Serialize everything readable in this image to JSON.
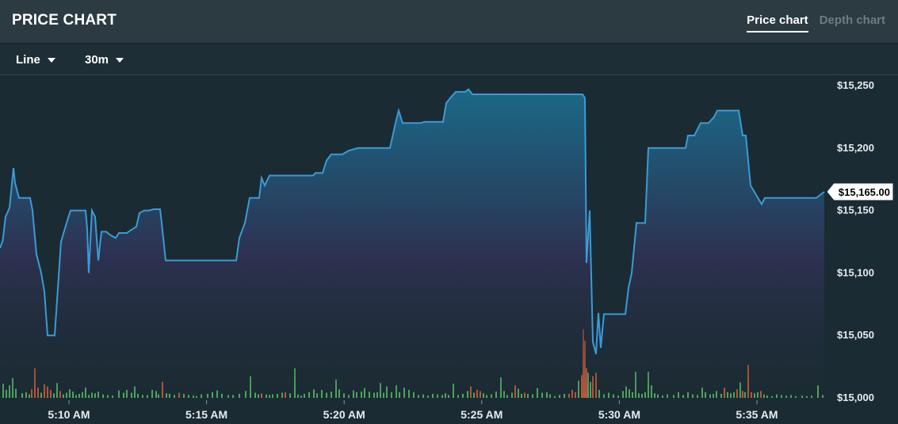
{
  "header": {
    "title": "PRICE CHART",
    "tabs": [
      {
        "label": "Price chart",
        "active": true
      },
      {
        "label": "Depth chart",
        "active": false
      }
    ]
  },
  "toolbar": {
    "chart_type": "Line",
    "interval": "30m"
  },
  "colors": {
    "line": "#3a9bd5",
    "volume_up": "#5cc46b",
    "volume_down": "#e0623a",
    "gradient_top": "#1a6c8c",
    "gradient_mid": "#2e3152"
  },
  "chart_data": {
    "type": "area",
    "xlabel": "",
    "ylabel": "",
    "ylim": [
      15000,
      15250
    ],
    "y_ticks": [
      "$15,250",
      "$15,200",
      "$15,150",
      "$15,100",
      "$15,050",
      "$15,000"
    ],
    "x_ticks": [
      "5:10 AM",
      "5:15 AM",
      "5:20 AM",
      "5:25 AM",
      "5:30 AM",
      "5:35 AM"
    ],
    "last_price_label": "$15,165.00",
    "price_series": {
      "name": "Price",
      "points": [
        [
          0.0,
          15120
        ],
        [
          3.5,
          15126
        ],
        [
          7,
          15145
        ],
        [
          12,
          15152
        ],
        [
          17,
          15184
        ],
        [
          19,
          15172
        ],
        [
          24,
          15160
        ],
        [
          38,
          15160
        ],
        [
          41,
          15150
        ],
        [
          46,
          15115
        ],
        [
          52,
          15100
        ],
        [
          56,
          15085
        ],
        [
          60,
          15050
        ],
        [
          69,
          15050
        ],
        [
          77,
          15125
        ],
        [
          84,
          15140
        ],
        [
          89,
          15150
        ],
        [
          108,
          15150
        ],
        [
          110,
          15135
        ],
        [
          112,
          15100
        ],
        [
          116,
          15150
        ],
        [
          120,
          15145
        ],
        [
          124,
          15110
        ],
        [
          128,
          15133
        ],
        [
          134,
          15133
        ],
        [
          140,
          15130
        ],
        [
          146,
          15128
        ],
        [
          150,
          15132
        ],
        [
          160,
          15132
        ],
        [
          167,
          15135
        ],
        [
          172,
          15137
        ],
        [
          176,
          15148
        ],
        [
          182,
          15150
        ],
        [
          188,
          15150
        ],
        [
          194,
          15151
        ],
        [
          202,
          15151
        ],
        [
          204,
          15140
        ],
        [
          209,
          15110
        ],
        [
          298,
          15110
        ],
        [
          302,
          15128
        ],
        [
          309,
          15140
        ],
        [
          315,
          15160
        ],
        [
          327,
          15160
        ],
        [
          330,
          15176
        ],
        [
          334,
          15170
        ],
        [
          340,
          15178
        ],
        [
          395,
          15178
        ],
        [
          398,
          15180
        ],
        [
          407,
          15180
        ],
        [
          412,
          15190
        ],
        [
          418,
          15195
        ],
        [
          432,
          15195
        ],
        [
          440,
          15198
        ],
        [
          452,
          15200
        ],
        [
          492,
          15200
        ],
        [
          499,
          15220
        ],
        [
          503,
          15230
        ],
        [
          508,
          15220
        ],
        [
          531,
          15220
        ],
        [
          535,
          15221
        ],
        [
          559,
          15221
        ],
        [
          563,
          15236
        ],
        [
          568,
          15240
        ],
        [
          575,
          15245
        ],
        [
          587,
          15245
        ],
        [
          591,
          15247
        ],
        [
          596,
          15243
        ],
        [
          735,
          15243
        ],
        [
          738,
          15240
        ],
        [
          740,
          15108
        ],
        [
          744,
          15150
        ],
        [
          748,
          15045
        ],
        [
          752,
          15035
        ],
        [
          755,
          15068
        ],
        [
          758,
          15040
        ],
        [
          762,
          15067
        ],
        [
          789,
          15067
        ],
        [
          793,
          15088
        ],
        [
          797,
          15100
        ],
        [
          803,
          15140
        ],
        [
          814,
          15140
        ],
        [
          818,
          15200
        ],
        [
          865,
          15200
        ],
        [
          868,
          15210
        ],
        [
          876,
          15210
        ],
        [
          884,
          15220
        ],
        [
          894,
          15220
        ],
        [
          901,
          15225
        ],
        [
          905,
          15230
        ],
        [
          932,
          15230
        ],
        [
          937,
          15210
        ],
        [
          941,
          15210
        ],
        [
          947,
          15170
        ],
        [
          961,
          15155
        ],
        [
          965,
          15160
        ],
        [
          1030,
          15160
        ],
        [
          1040,
          15165
        ]
      ]
    },
    "volume_series": {
      "name": "Volume",
      "bars": [
        [
          4,
          25,
          "up"
        ],
        [
          8,
          14,
          "up"
        ],
        [
          12,
          22,
          "up"
        ],
        [
          16,
          35,
          "up"
        ],
        [
          20,
          16,
          "up"
        ],
        [
          28,
          8,
          "up"
        ],
        [
          33,
          10,
          "up"
        ],
        [
          37,
          6,
          "up"
        ],
        [
          40,
          15,
          "down"
        ],
        [
          44,
          52,
          "down"
        ],
        [
          48,
          18,
          "down"
        ],
        [
          52,
          9,
          "up"
        ],
        [
          56,
          24,
          "down"
        ],
        [
          60,
          20,
          "down"
        ],
        [
          64,
          14,
          "down"
        ],
        [
          68,
          8,
          "up"
        ],
        [
          72,
          26,
          "up"
        ],
        [
          76,
          12,
          "down"
        ],
        [
          80,
          6,
          "up"
        ],
        [
          84,
          9,
          "up"
        ],
        [
          88,
          15,
          "up"
        ],
        [
          92,
          11,
          "up"
        ],
        [
          96,
          5,
          "up"
        ],
        [
          100,
          7,
          "up"
        ],
        [
          104,
          10,
          "up"
        ],
        [
          108,
          18,
          "up"
        ],
        [
          112,
          5,
          "up"
        ],
        [
          116,
          9,
          "up"
        ],
        [
          120,
          8,
          "up"
        ],
        [
          124,
          11,
          "up"
        ],
        [
          130,
          6,
          "up"
        ],
        [
          136,
          5,
          "up"
        ],
        [
          142,
          4,
          "up"
        ],
        [
          150,
          13,
          "up"
        ],
        [
          156,
          9,
          "up"
        ],
        [
          160,
          14,
          "up"
        ],
        [
          166,
          9,
          "up"
        ],
        [
          170,
          20,
          "up"
        ],
        [
          174,
          7,
          "up"
        ],
        [
          180,
          5,
          "up"
        ],
        [
          186,
          5,
          "up"
        ],
        [
          192,
          14,
          "up"
        ],
        [
          197,
          12,
          "up"
        ],
        [
          200,
          6,
          "up"
        ],
        [
          205,
          28,
          "down"
        ],
        [
          210,
          8,
          "up"
        ],
        [
          214,
          7,
          "up"
        ],
        [
          220,
          5,
          "up"
        ],
        [
          226,
          9,
          "down"
        ],
        [
          232,
          7,
          "up"
        ],
        [
          238,
          5,
          "up"
        ],
        [
          244,
          4,
          "up"
        ],
        [
          248,
          3,
          "up"
        ],
        [
          254,
          6,
          "up"
        ],
        [
          262,
          7,
          "up"
        ],
        [
          268,
          10,
          "up"
        ],
        [
          274,
          13,
          "up"
        ],
        [
          280,
          7,
          "up"
        ],
        [
          288,
          5,
          "up"
        ],
        [
          294,
          5,
          "up"
        ],
        [
          302,
          7,
          "up"
        ],
        [
          310,
          12,
          "up"
        ],
        [
          316,
          38,
          "up"
        ],
        [
          322,
          9,
          "up"
        ],
        [
          326,
          6,
          "up"
        ],
        [
          330,
          8,
          "down"
        ],
        [
          336,
          6,
          "up"
        ],
        [
          340,
          5,
          "up"
        ],
        [
          344,
          6,
          "up"
        ],
        [
          350,
          7,
          "up"
        ],
        [
          356,
          9,
          "up"
        ],
        [
          360,
          10,
          "down"
        ],
        [
          366,
          8,
          "up"
        ],
        [
          372,
          52,
          "up"
        ],
        [
          376,
          6,
          "up"
        ],
        [
          380,
          4,
          "up"
        ],
        [
          384,
          7,
          "up"
        ],
        [
          390,
          10,
          "up"
        ],
        [
          396,
          15,
          "up"
        ],
        [
          400,
          8,
          "up"
        ],
        [
          406,
          14,
          "up"
        ],
        [
          412,
          9,
          "up"
        ],
        [
          418,
          11,
          "up"
        ],
        [
          424,
          32,
          "up"
        ],
        [
          428,
          15,
          "up"
        ],
        [
          434,
          8,
          "up"
        ],
        [
          440,
          5,
          "up"
        ],
        [
          446,
          13,
          "up"
        ],
        [
          450,
          10,
          "up"
        ],
        [
          456,
          11,
          "up"
        ],
        [
          460,
          17,
          "up"
        ],
        [
          466,
          11,
          "up"
        ],
        [
          472,
          9,
          "up"
        ],
        [
          476,
          10,
          "up"
        ],
        [
          480,
          26,
          "up"
        ],
        [
          484,
          9,
          "up"
        ],
        [
          488,
          20,
          "up"
        ],
        [
          494,
          10,
          "up"
        ],
        [
          500,
          22,
          "up"
        ],
        [
          504,
          10,
          "up"
        ],
        [
          510,
          18,
          "up"
        ],
        [
          516,
          14,
          "up"
        ],
        [
          522,
          10,
          "up"
        ],
        [
          528,
          5,
          "up"
        ],
        [
          534,
          6,
          "up"
        ],
        [
          540,
          4,
          "up"
        ],
        [
          546,
          7,
          "up"
        ],
        [
          552,
          6,
          "up"
        ],
        [
          558,
          5,
          "up"
        ],
        [
          562,
          8,
          "up"
        ],
        [
          566,
          5,
          "up"
        ],
        [
          572,
          25,
          "up"
        ],
        [
          578,
          5,
          "up"
        ],
        [
          584,
          7,
          "up"
        ],
        [
          590,
          12,
          "up"
        ],
        [
          594,
          20,
          "down"
        ],
        [
          598,
          9,
          "up"
        ],
        [
          602,
          14,
          "down"
        ],
        [
          606,
          12,
          "down"
        ],
        [
          610,
          8,
          "up"
        ],
        [
          614,
          5,
          "up"
        ],
        [
          620,
          6,
          "up"
        ],
        [
          626,
          11,
          "up"
        ],
        [
          632,
          36,
          "up"
        ],
        [
          636,
          12,
          "up"
        ],
        [
          640,
          5,
          "up"
        ],
        [
          646,
          9,
          "up"
        ],
        [
          650,
          22,
          "down"
        ],
        [
          654,
          16,
          "up"
        ],
        [
          658,
          7,
          "up"
        ],
        [
          662,
          9,
          "down"
        ],
        [
          666,
          7,
          "up"
        ],
        [
          672,
          6,
          "up"
        ],
        [
          678,
          17,
          "up"
        ],
        [
          684,
          9,
          "up"
        ],
        [
          690,
          10,
          "up"
        ],
        [
          694,
          6,
          "up"
        ],
        [
          700,
          3,
          "up"
        ],
        [
          706,
          5,
          "up"
        ],
        [
          712,
          7,
          "up"
        ],
        [
          718,
          7,
          "down"
        ],
        [
          722,
          14,
          "down"
        ],
        [
          726,
          10,
          "down"
        ],
        [
          730,
          30,
          "up"
        ],
        [
          734,
          40,
          "down"
        ],
        [
          736,
          120,
          "down"
        ],
        [
          738,
          100,
          "down"
        ],
        [
          740,
          52,
          "down"
        ],
        [
          742,
          44,
          "up"
        ],
        [
          745,
          28,
          "up"
        ],
        [
          748,
          38,
          "down"
        ],
        [
          752,
          44,
          "down"
        ],
        [
          756,
          14,
          "up"
        ],
        [
          762,
          6,
          "up"
        ],
        [
          768,
          9,
          "up"
        ],
        [
          774,
          6,
          "up"
        ],
        [
          780,
          4,
          "up"
        ],
        [
          786,
          12,
          "up"
        ],
        [
          790,
          20,
          "up"
        ],
        [
          794,
          15,
          "up"
        ],
        [
          798,
          10,
          "up"
        ],
        [
          802,
          46,
          "up"
        ],
        [
          806,
          8,
          "up"
        ],
        [
          810,
          7,
          "up"
        ],
        [
          814,
          10,
          "up"
        ],
        [
          818,
          46,
          "up"
        ],
        [
          822,
          22,
          "up"
        ],
        [
          826,
          8,
          "up"
        ],
        [
          830,
          6,
          "up"
        ],
        [
          836,
          4,
          "up"
        ],
        [
          842,
          6,
          "up"
        ],
        [
          850,
          5,
          "up"
        ],
        [
          856,
          10,
          "up"
        ],
        [
          862,
          5,
          "up"
        ],
        [
          868,
          10,
          "up"
        ],
        [
          874,
          6,
          "up"
        ],
        [
          880,
          5,
          "up"
        ],
        [
          886,
          18,
          "up"
        ],
        [
          890,
          10,
          "up"
        ],
        [
          896,
          6,
          "up"
        ],
        [
          900,
          7,
          "up"
        ],
        [
          904,
          12,
          "up"
        ],
        [
          910,
          7,
          "up"
        ],
        [
          914,
          18,
          "down"
        ],
        [
          918,
          10,
          "up"
        ],
        [
          922,
          8,
          "up"
        ],
        [
          926,
          10,
          "up"
        ],
        [
          930,
          15,
          "down"
        ],
        [
          934,
          27,
          "up"
        ],
        [
          937,
          12,
          "down"
        ],
        [
          940,
          10,
          "up"
        ],
        [
          944,
          58,
          "down"
        ],
        [
          948,
          10,
          "down"
        ],
        [
          952,
          8,
          "up"
        ],
        [
          956,
          10,
          "up"
        ],
        [
          960,
          12,
          "down"
        ],
        [
          964,
          6,
          "up"
        ],
        [
          968,
          4,
          "up"
        ],
        [
          974,
          3,
          "up"
        ],
        [
          980,
          6,
          "up"
        ],
        [
          986,
          5,
          "up"
        ],
        [
          992,
          4,
          "up"
        ],
        [
          998,
          5,
          "up"
        ],
        [
          1004,
          3,
          "up"
        ],
        [
          1012,
          4,
          "up"
        ],
        [
          1018,
          3,
          "up"
        ],
        [
          1024,
          4,
          "up"
        ],
        [
          1032,
          22,
          "up"
        ],
        [
          1038,
          5,
          "up"
        ]
      ]
    },
    "grid": false,
    "legend": "none"
  }
}
